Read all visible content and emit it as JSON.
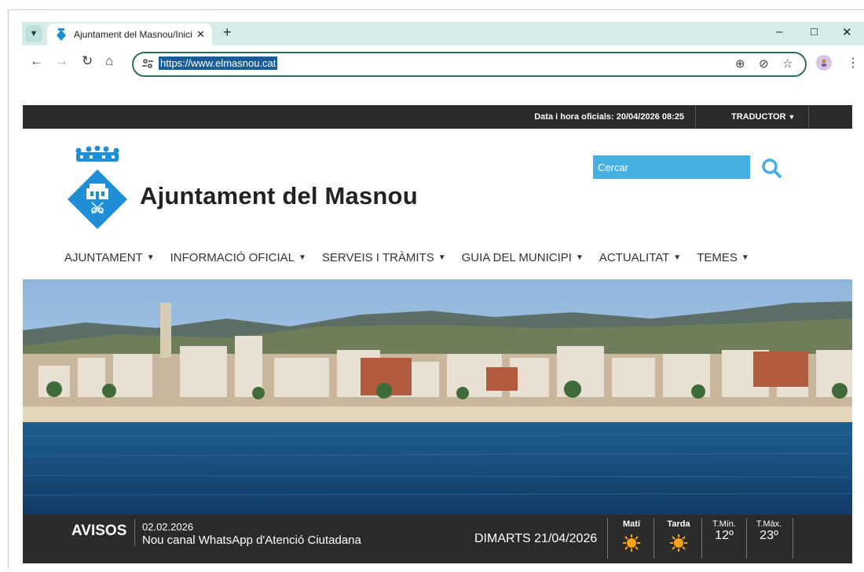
{
  "browser": {
    "tab_title": "Ajuntament del Masnou/Inici",
    "url": "https://www.elmasnou.cat"
  },
  "site": {
    "topbar": {
      "official_datetime": "Data i hora oficials: 20/04/2026 08:25",
      "translator": "TRADUCTOR"
    },
    "title": "Ajuntament del Masnou",
    "search_placeholder": "Cercar",
    "nav": [
      "AJUNTAMENT",
      "INFORMACIÓ OFICIAL",
      "SERVEIS I TRÀMITS",
      "GUIA DEL MUNICIPI",
      "ACTUALITAT",
      "TEMES"
    ],
    "notices": {
      "label": "AVISOS",
      "date": "02.02.2026",
      "text": "Nou canal WhatsApp d'Atenció Ciutadana"
    },
    "weather": {
      "today": "DIMARTS 21/04/2026",
      "morning_label": "Matí",
      "afternoon_label": "Tarda",
      "min_label": "T.Mín.",
      "min_value": "12º",
      "max_label": "T.Màx.",
      "max_value": "23º",
      "morning_icon": "sun-icon",
      "afternoon_icon": "sun-icon"
    }
  },
  "colors": {
    "accent": "#46b0e3",
    "dark_bar": "#2b2b2b",
    "sun": "#f7a21b"
  }
}
